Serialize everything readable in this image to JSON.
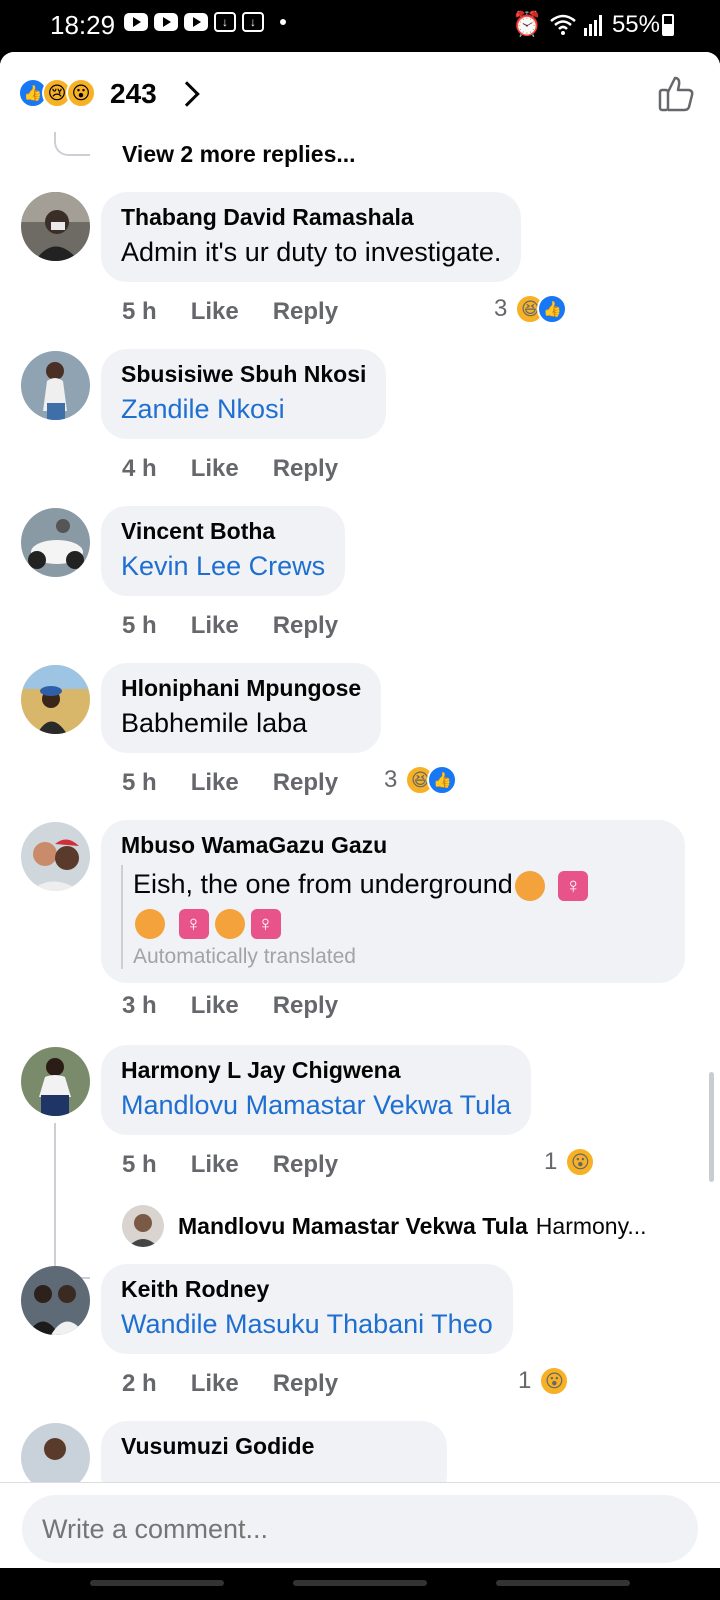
{
  "status": {
    "time": "18:29",
    "battery": "55%"
  },
  "header": {
    "reaction_count": "243"
  },
  "view_more": "View 2 more replies...",
  "comments": [
    {
      "author": "Thabang David Ramashala",
      "text": "Admin it's ur duty to investigate.",
      "time": "5 h",
      "like": "Like",
      "reply": "Reply",
      "reaction_count": "3"
    },
    {
      "author": "Sbusisiwe Sbuh Nkosi",
      "text": "Zandile Nkosi",
      "time": "4 h",
      "like": "Like",
      "reply": "Reply"
    },
    {
      "author": "Vincent Botha",
      "text": "Kevin Lee Crews",
      "time": "5 h",
      "like": "Like",
      "reply": "Reply"
    },
    {
      "author": "Hloniphani Mpungose",
      "text": "Babhemile laba",
      "time": "5 h",
      "like": "Like",
      "reply": "Reply",
      "reaction_count": "3"
    },
    {
      "author": "Mbuso WamaGazu Gazu",
      "text": "Eish, the one from underground",
      "note": "Automatically translated",
      "time": "3 h",
      "like": "Like",
      "reply": "Reply"
    },
    {
      "author": "Harmony L Jay Chigwena",
      "text": "Mandlovu Mamastar Vekwa Tula",
      "time": "5 h",
      "like": "Like",
      "reply": "Reply",
      "reaction_count": "1"
    },
    {
      "author": "Keith Rodney",
      "text": "Wandile Masuku Thabani Theo",
      "time": "2 h",
      "like": "Like",
      "reply": "Reply",
      "reaction_count": "1"
    },
    {
      "author": "Vusumuzi Godide"
    }
  ],
  "reply_preview": {
    "author": "Mandlovu Mamastar Vekwa Tula",
    "snippet": "Harmony..."
  },
  "composer": {
    "placeholder": "Write a comment..."
  }
}
